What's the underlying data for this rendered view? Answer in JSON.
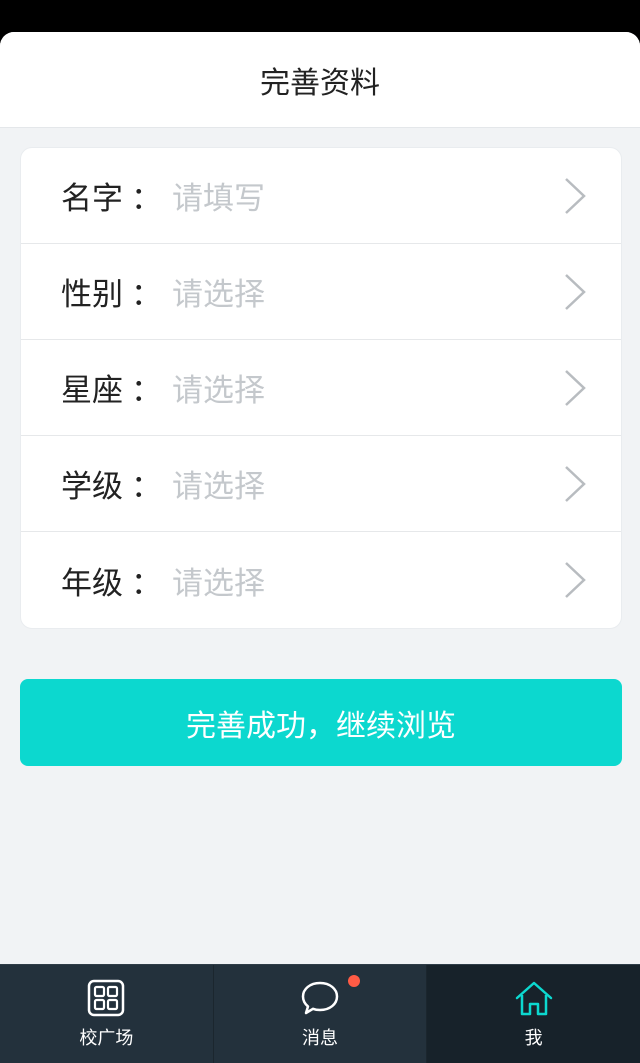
{
  "header": {
    "title": "完善资料"
  },
  "form": {
    "rows": [
      {
        "label": "名字",
        "colon": "：",
        "placeholder": "请填写"
      },
      {
        "label": "性别",
        "colon": "：",
        "placeholder": "请选择"
      },
      {
        "label": "星座",
        "colon": "：",
        "placeholder": "请选择"
      },
      {
        "label": "学级",
        "colon": "：",
        "placeholder": "请选择"
      },
      {
        "label": "年级",
        "colon": "：",
        "placeholder": "请选择"
      }
    ]
  },
  "primary_button": {
    "label": "完善成功，继续浏览"
  },
  "tabbar": {
    "tabs": [
      {
        "label": "校广场",
        "icon": "grid-icon",
        "active": false
      },
      {
        "label": "消息",
        "icon": "chat-bubble-icon",
        "active": false,
        "badge": true
      },
      {
        "label": "我",
        "icon": "home-icon",
        "active": true
      }
    ]
  },
  "colors": {
    "accent": "#0cd8cf",
    "tabbar_bg": "#23313c",
    "badge": "#ff5b45",
    "placeholder": "#c4c8cc"
  }
}
